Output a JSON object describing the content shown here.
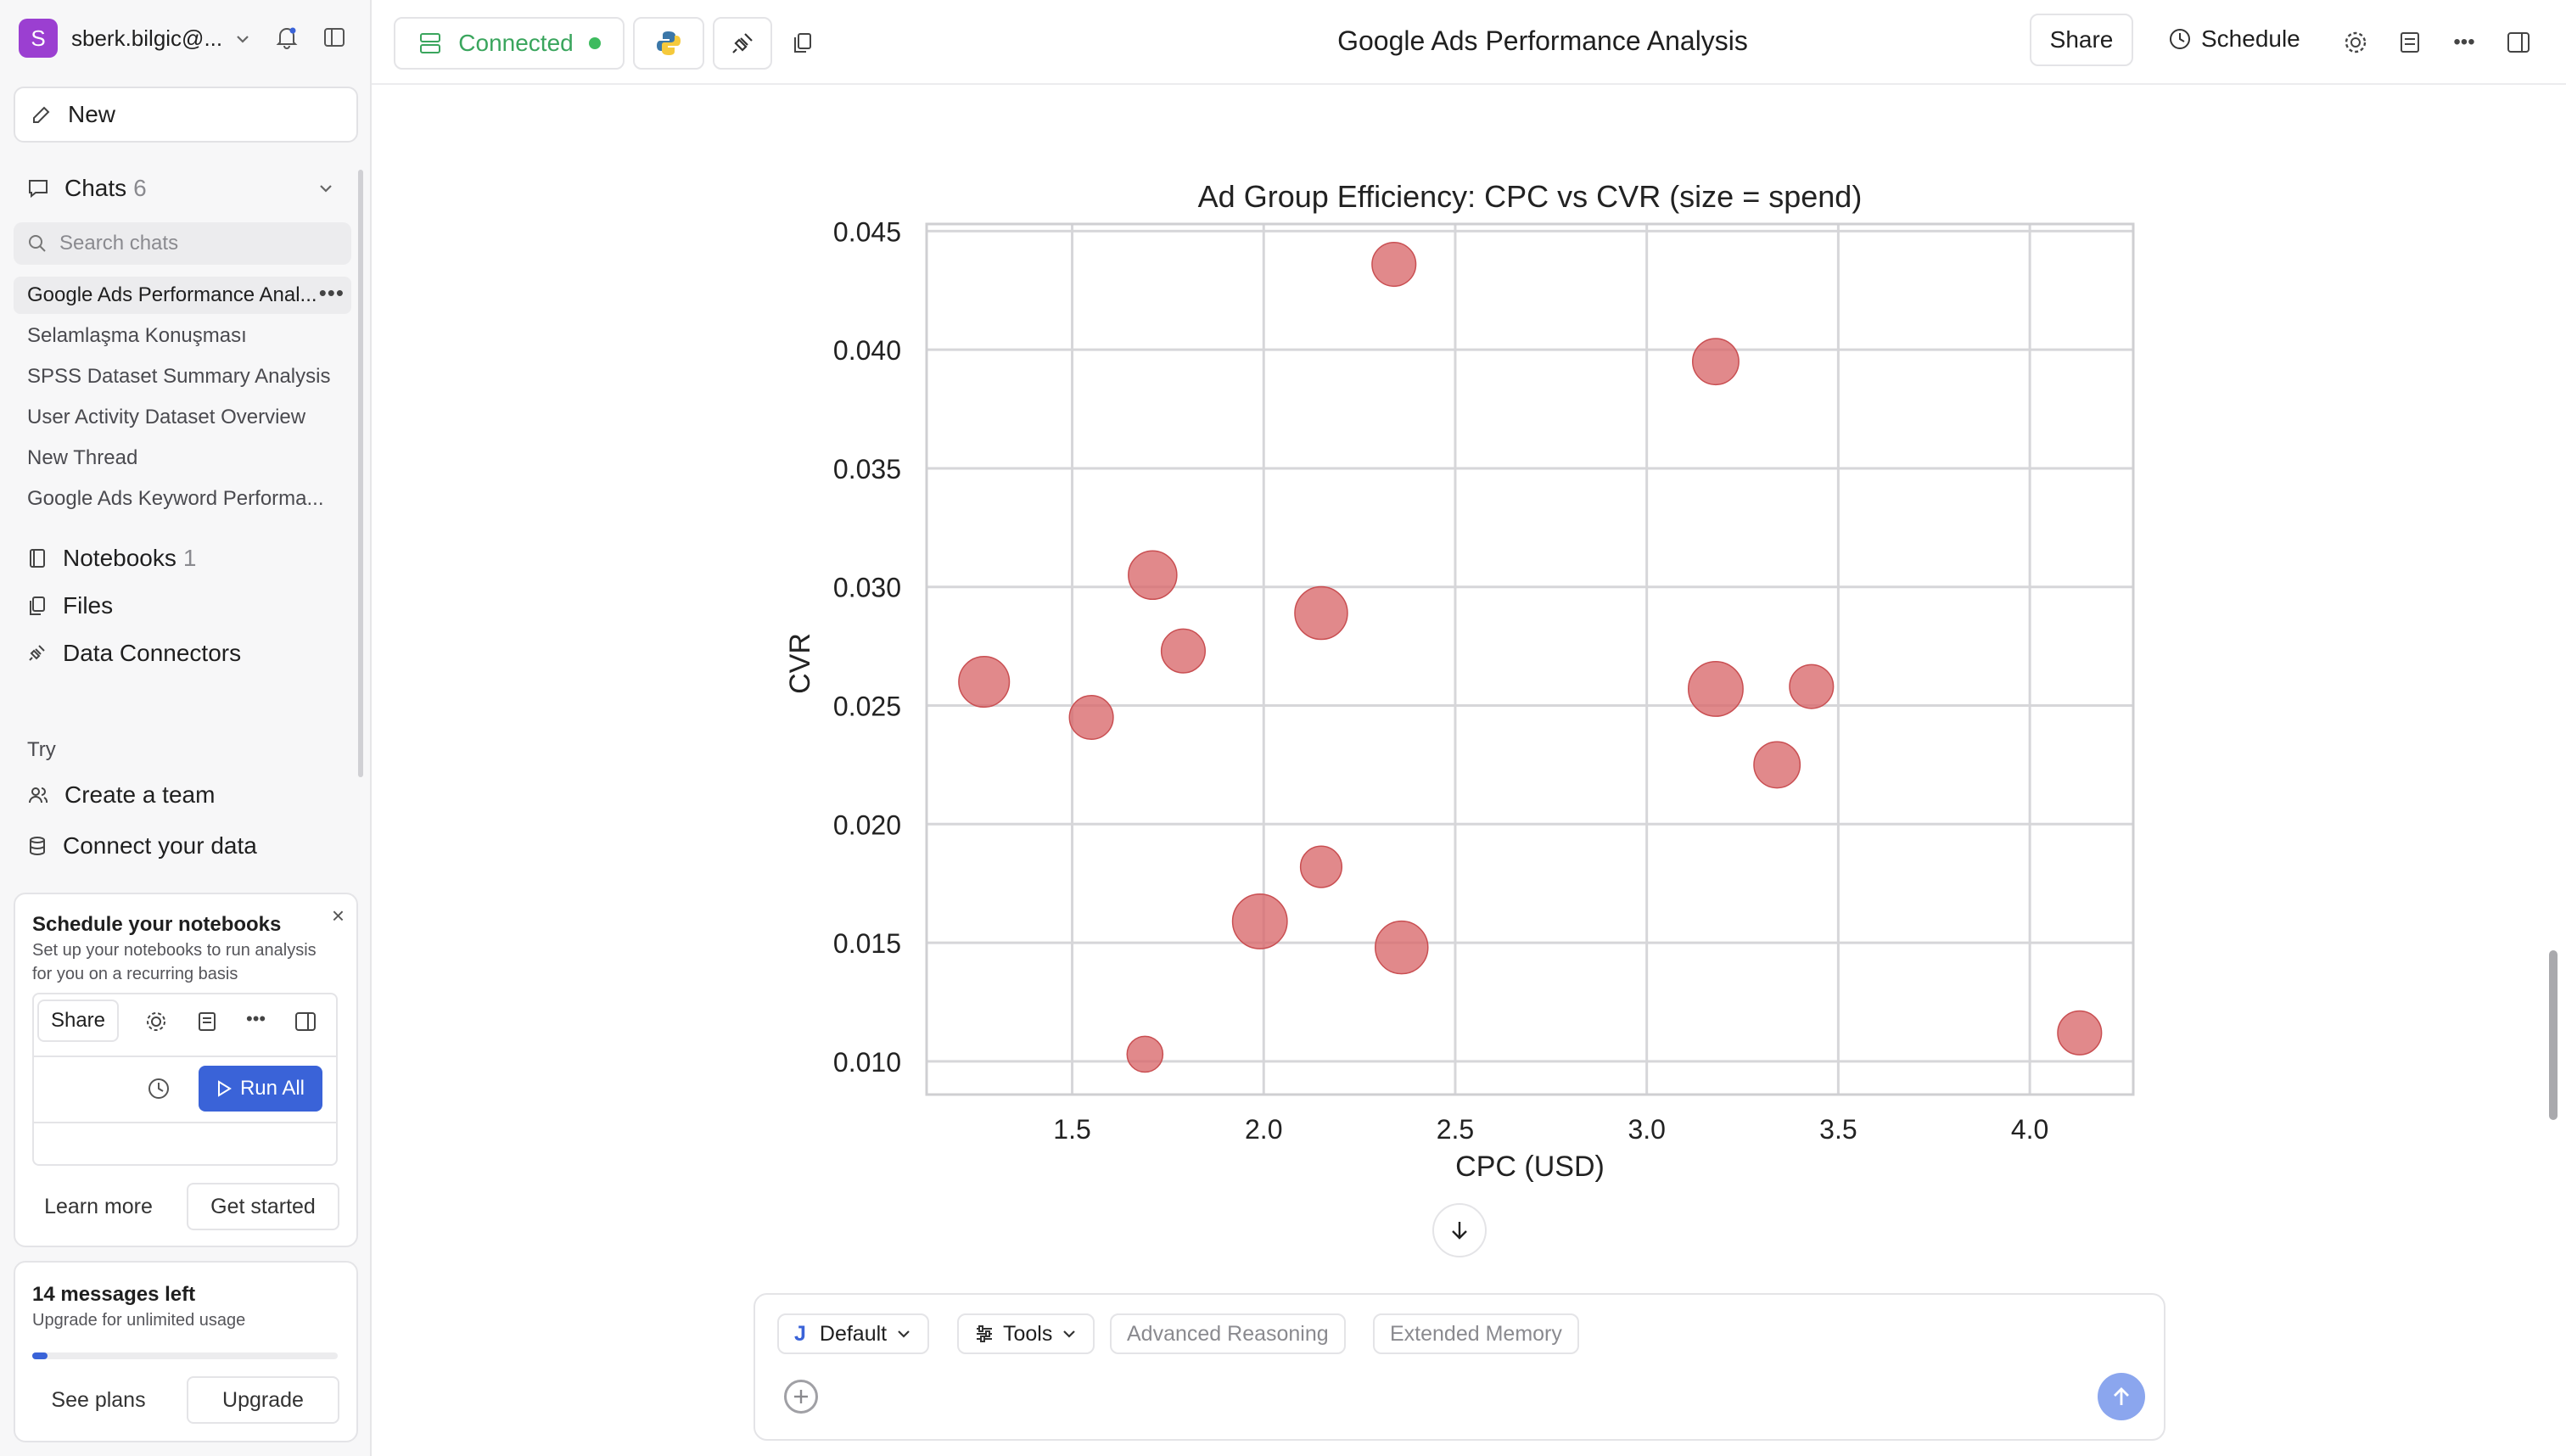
{
  "sidebar": {
    "account": {
      "initial": "S",
      "name": "sberk.bilgic@..."
    },
    "new_label": "New",
    "chats": {
      "label": "Chats",
      "count": "6"
    },
    "search": {
      "placeholder": "Search chats"
    },
    "chat_items": [
      {
        "label": "Google Ads Performance Anal..."
      },
      {
        "label": "Selamlaşma Konuşması"
      },
      {
        "label": "SPSS Dataset Summary Analysis"
      },
      {
        "label": "User Activity Dataset Overview"
      },
      {
        "label": "New Thread"
      },
      {
        "label": "Google Ads Keyword Performa..."
      }
    ],
    "notebooks": {
      "label": "Notebooks",
      "count": "1"
    },
    "files_label": "Files",
    "connectors_label": "Data Connectors",
    "try_label": "Try",
    "create_team_label": "Create a team",
    "connect_data_label": "Connect your data",
    "schedule_card": {
      "title": "Schedule your notebooks",
      "subtitle_line1": "Set up your notebooks to run analysis",
      "subtitle_line2": "for you on a recurring basis",
      "share_label": "Share",
      "run_all_label": "Run All",
      "learn_more": "Learn more",
      "get_started": "Get started"
    },
    "usage_card": {
      "title": "14 messages left",
      "subtitle": "Upgrade for unlimited usage",
      "progress": 0.05,
      "see_plans": "See plans",
      "upgrade": "Upgrade"
    }
  },
  "topbar": {
    "status": "Connected",
    "title": "Google Ads Performance Analysis",
    "share_label": "Share",
    "schedule_label": "Schedule"
  },
  "chart_data": {
    "type": "scatter",
    "title": "Ad Group Efficiency: CPC vs CVR (size = spend)",
    "xlabel": "CPC (USD)",
    "ylabel": "CVR",
    "xlim": [
      1.12,
      4.27
    ],
    "ylim": [
      0.0086,
      0.0453
    ],
    "xticks": [
      "1.5",
      "2.0",
      "2.5",
      "3.0",
      "3.5",
      "4.0"
    ],
    "yticks": [
      "0.010",
      "0.015",
      "0.020",
      "0.025",
      "0.030",
      "0.035",
      "0.040",
      "0.045"
    ],
    "grid": true,
    "color": "#d9686a",
    "points": [
      {
        "x": 1.27,
        "y": 0.026,
        "size": 1.2
      },
      {
        "x": 1.55,
        "y": 0.0245,
        "size": 0.9
      },
      {
        "x": 1.69,
        "y": 0.0103,
        "size": 0.6
      },
      {
        "x": 1.71,
        "y": 0.0305,
        "size": 1.1
      },
      {
        "x": 1.79,
        "y": 0.0273,
        "size": 0.9
      },
      {
        "x": 1.99,
        "y": 0.0159,
        "size": 1.4
      },
      {
        "x": 2.15,
        "y": 0.0289,
        "size": 1.3
      },
      {
        "x": 2.15,
        "y": 0.0182,
        "size": 0.8
      },
      {
        "x": 2.34,
        "y": 0.0436,
        "size": 0.9
      },
      {
        "x": 2.36,
        "y": 0.0148,
        "size": 1.3
      },
      {
        "x": 3.18,
        "y": 0.0395,
        "size": 1.0
      },
      {
        "x": 3.18,
        "y": 0.0257,
        "size": 1.4
      },
      {
        "x": 3.34,
        "y": 0.0225,
        "size": 1.0
      },
      {
        "x": 3.43,
        "y": 0.0258,
        "size": 0.9
      },
      {
        "x": 4.13,
        "y": 0.0112,
        "size": 0.9
      }
    ]
  },
  "composer": {
    "model_label": "Default",
    "model_initial": "J",
    "tools_label": "Tools",
    "advanced_label": "Advanced Reasoning",
    "memory_label": "Extended Memory"
  }
}
